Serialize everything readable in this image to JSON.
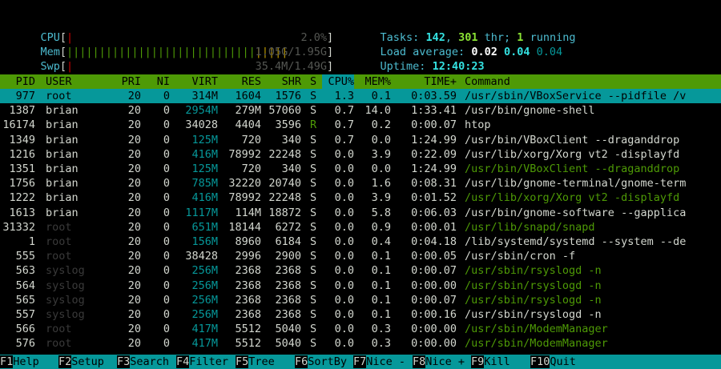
{
  "meters": {
    "cpu": {
      "label": "CPU",
      "bar_red": "|",
      "value": "2.0%"
    },
    "mem": {
      "label": "Mem",
      "bar_green": "|||||||||||||||||||||||||||||",
      "bar_orange": "|||||",
      "value": "1.05G/1.95G"
    },
    "swp": {
      "label": "Swp",
      "bar_red": "|",
      "value": "35.4M/1.49G"
    }
  },
  "stats": {
    "tasks_label": "Tasks:",
    "tasks": "142",
    "thr": "301",
    "thr_label": "thr;",
    "running": "1",
    "running_label": "running",
    "load_label": "Load average:",
    "load1": "0.02",
    "load5": "0.04",
    "load15": "0.04",
    "uptime_label": "Uptime:",
    "uptime": "12:40:23"
  },
  "columns": {
    "pid": "PID",
    "user": "USER",
    "pri": "PRI",
    "ni": "NI",
    "virt": "VIRT",
    "res": "RES",
    "shr": "SHR",
    "s": "S",
    "cpu": "CPU%",
    "mem": "MEM%",
    "time": "TIME+",
    "command": "Command"
  },
  "processes": [
    {
      "pid": "977",
      "user": "root",
      "pri": "20",
      "ni": "0",
      "virt": "314M",
      "res": "1604",
      "shr": "1576",
      "s": "S",
      "cpu": "1.3",
      "mem": "0.1",
      "time": "0:03.59",
      "cmd": "/usr/sbin/VBoxService --pidfile /v"
    },
    {
      "pid": "1387",
      "user": "brian",
      "pri": "20",
      "ni": "0",
      "virt": "2954M",
      "res": "279M",
      "shr": "57060",
      "s": "S",
      "cpu": "0.7",
      "mem": "14.0",
      "time": "1:33.41",
      "cmd": "/usr/bin/gnome-shell"
    },
    {
      "pid": "16174",
      "user": "brian",
      "pri": "20",
      "ni": "0",
      "virt": "34028",
      "res": "4404",
      "shr": "3596",
      "s": "R",
      "cpu": "0.7",
      "mem": "0.2",
      "time": "0:00.07",
      "cmd": "htop"
    },
    {
      "pid": "1349",
      "user": "brian",
      "pri": "20",
      "ni": "0",
      "virt": "125M",
      "res": "720",
      "shr": "340",
      "s": "S",
      "cpu": "0.7",
      "mem": "0.0",
      "time": "1:24.99",
      "cmd": "/usr/bin/VBoxClient --draganddrop"
    },
    {
      "pid": "1216",
      "user": "brian",
      "pri": "20",
      "ni": "0",
      "virt": "416M",
      "res": "78992",
      "shr": "22248",
      "s": "S",
      "cpu": "0.0",
      "mem": "3.9",
      "time": "0:22.09",
      "cmd": "/usr/lib/xorg/Xorg vt2 -displayfd"
    },
    {
      "pid": "1351",
      "user": "brian",
      "pri": "20",
      "ni": "0",
      "virt": "125M",
      "res": "720",
      "shr": "340",
      "s": "S",
      "cpu": "0.0",
      "mem": "0.0",
      "time": "1:24.99",
      "cmd": "/usr/bin/VBoxClient --draganddrop"
    },
    {
      "pid": "1756",
      "user": "brian",
      "pri": "20",
      "ni": "0",
      "virt": "785M",
      "res": "32220",
      "shr": "20740",
      "s": "S",
      "cpu": "0.0",
      "mem": "1.6",
      "time": "0:08.31",
      "cmd": "/usr/lib/gnome-terminal/gnome-term"
    },
    {
      "pid": "1222",
      "user": "brian",
      "pri": "20",
      "ni": "0",
      "virt": "416M",
      "res": "78992",
      "shr": "22248",
      "s": "S",
      "cpu": "0.0",
      "mem": "3.9",
      "time": "0:01.52",
      "cmd": "/usr/lib/xorg/Xorg vt2 -displayfd"
    },
    {
      "pid": "1613",
      "user": "brian",
      "pri": "20",
      "ni": "0",
      "virt": "1117M",
      "res": "114M",
      "shr": "18872",
      "s": "S",
      "cpu": "0.0",
      "mem": "5.8",
      "time": "0:06.03",
      "cmd": "/usr/bin/gnome-software --gapplica"
    },
    {
      "pid": "31332",
      "user": "root",
      "pri": "20",
      "ni": "0",
      "virt": "651M",
      "res": "18144",
      "shr": "6272",
      "s": "S",
      "cpu": "0.0",
      "mem": "0.9",
      "time": "0:00.01",
      "cmd": "/usr/lib/snapd/snapd"
    },
    {
      "pid": "1",
      "user": "root",
      "pri": "20",
      "ni": "0",
      "virt": "156M",
      "res": "8960",
      "shr": "6184",
      "s": "S",
      "cpu": "0.0",
      "mem": "0.4",
      "time": "0:04.18",
      "cmd": "/lib/systemd/systemd --system --de"
    },
    {
      "pid": "555",
      "user": "root",
      "pri": "20",
      "ni": "0",
      "virt": "38428",
      "res": "2996",
      "shr": "2900",
      "s": "S",
      "cpu": "0.0",
      "mem": "0.1",
      "time": "0:00.05",
      "cmd": "/usr/sbin/cron -f"
    },
    {
      "pid": "563",
      "user": "syslog",
      "pri": "20",
      "ni": "0",
      "virt": "256M",
      "res": "2368",
      "shr": "2368",
      "s": "S",
      "cpu": "0.0",
      "mem": "0.1",
      "time": "0:00.07",
      "cmd": "/usr/sbin/rsyslogd -n"
    },
    {
      "pid": "564",
      "user": "syslog",
      "pri": "20",
      "ni": "0",
      "virt": "256M",
      "res": "2368",
      "shr": "2368",
      "s": "S",
      "cpu": "0.0",
      "mem": "0.1",
      "time": "0:00.00",
      "cmd": "/usr/sbin/rsyslogd -n"
    },
    {
      "pid": "565",
      "user": "syslog",
      "pri": "20",
      "ni": "0",
      "virt": "256M",
      "res": "2368",
      "shr": "2368",
      "s": "S",
      "cpu": "0.0",
      "mem": "0.1",
      "time": "0:00.07",
      "cmd": "/usr/sbin/rsyslogd -n"
    },
    {
      "pid": "557",
      "user": "syslog",
      "pri": "20",
      "ni": "0",
      "virt": "256M",
      "res": "2368",
      "shr": "2368",
      "s": "S",
      "cpu": "0.0",
      "mem": "0.1",
      "time": "0:00.16",
      "cmd": "/usr/sbin/rsyslogd -n"
    },
    {
      "pid": "566",
      "user": "root",
      "pri": "20",
      "ni": "0",
      "virt": "417M",
      "res": "5512",
      "shr": "5040",
      "s": "S",
      "cpu": "0.0",
      "mem": "0.3",
      "time": "0:00.00",
      "cmd": "/usr/sbin/ModemManager"
    },
    {
      "pid": "576",
      "user": "root",
      "pri": "20",
      "ni": "0",
      "virt": "417M",
      "res": "5512",
      "shr": "5040",
      "s": "S",
      "cpu": "0.0",
      "mem": "0.3",
      "time": "0:00.00",
      "cmd": "/usr/sbin/ModemManager"
    }
  ],
  "footer": [
    {
      "key": "F1",
      "label": "Help"
    },
    {
      "key": "F2",
      "label": "Setup"
    },
    {
      "key": "F3",
      "label": "Search"
    },
    {
      "key": "F4",
      "label": "Filter"
    },
    {
      "key": "F5",
      "label": "Tree"
    },
    {
      "key": "F6",
      "label": "SortBy"
    },
    {
      "key": "F7",
      "label": "Nice -"
    },
    {
      "key": "F8",
      "label": "Nice +"
    },
    {
      "key": "F9",
      "label": "Kill"
    },
    {
      "key": "F10",
      "label": "Quit"
    }
  ]
}
